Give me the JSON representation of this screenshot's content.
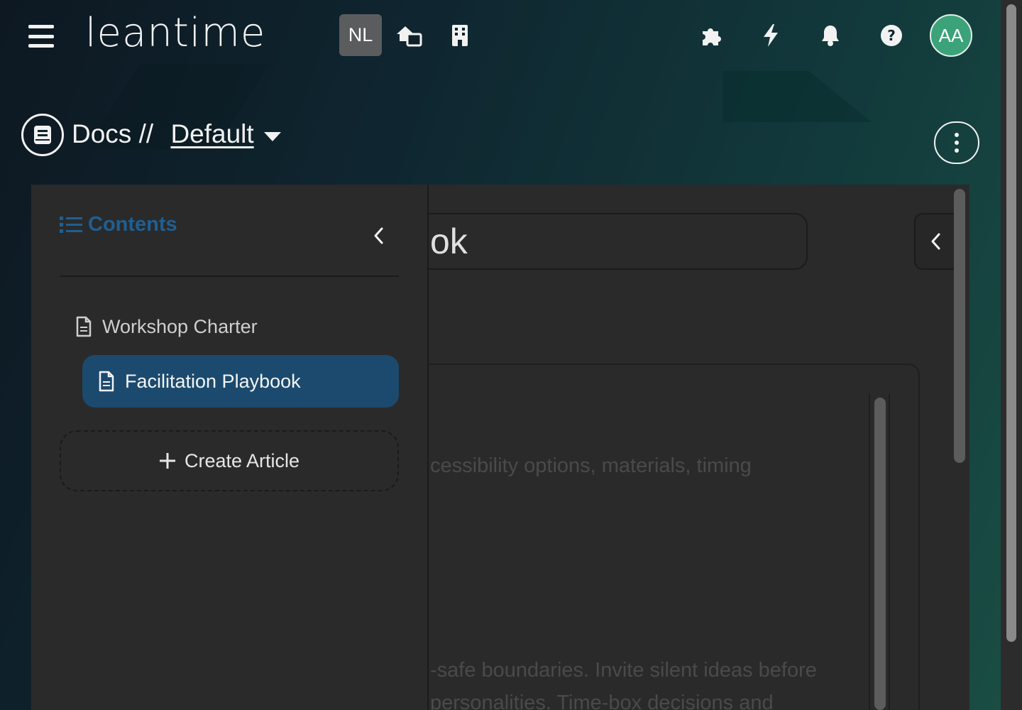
{
  "header": {
    "logo_text": "leantime",
    "workspace_badge": "NL",
    "user_initials": "AA",
    "icons": [
      "menu-icon",
      "home-switch-icon",
      "building-icon",
      "puzzle-icon",
      "bolt-icon",
      "bell-icon",
      "help-icon"
    ]
  },
  "page": {
    "section": "Docs",
    "separator": "//",
    "board": "Default"
  },
  "sidebar": {
    "heading": "Contents",
    "items": [
      {
        "label": "Workshop Charter",
        "active": false
      },
      {
        "label": "Facilitation Playbook",
        "active": true
      }
    ],
    "create_label": "Create Article"
  },
  "article": {
    "title_visible": "ok",
    "body_lines": [
      "cessibility options, materials, timing",
      "-safe boundaries. Invite silent ideas before",
      "personalities. Time-box decisions and"
    ]
  },
  "colors": {
    "panel_bg": "#2a2a2a",
    "active_item": "#1b4a6e",
    "contents_heading": "#1f5f92",
    "avatar": "#3ca27a"
  }
}
